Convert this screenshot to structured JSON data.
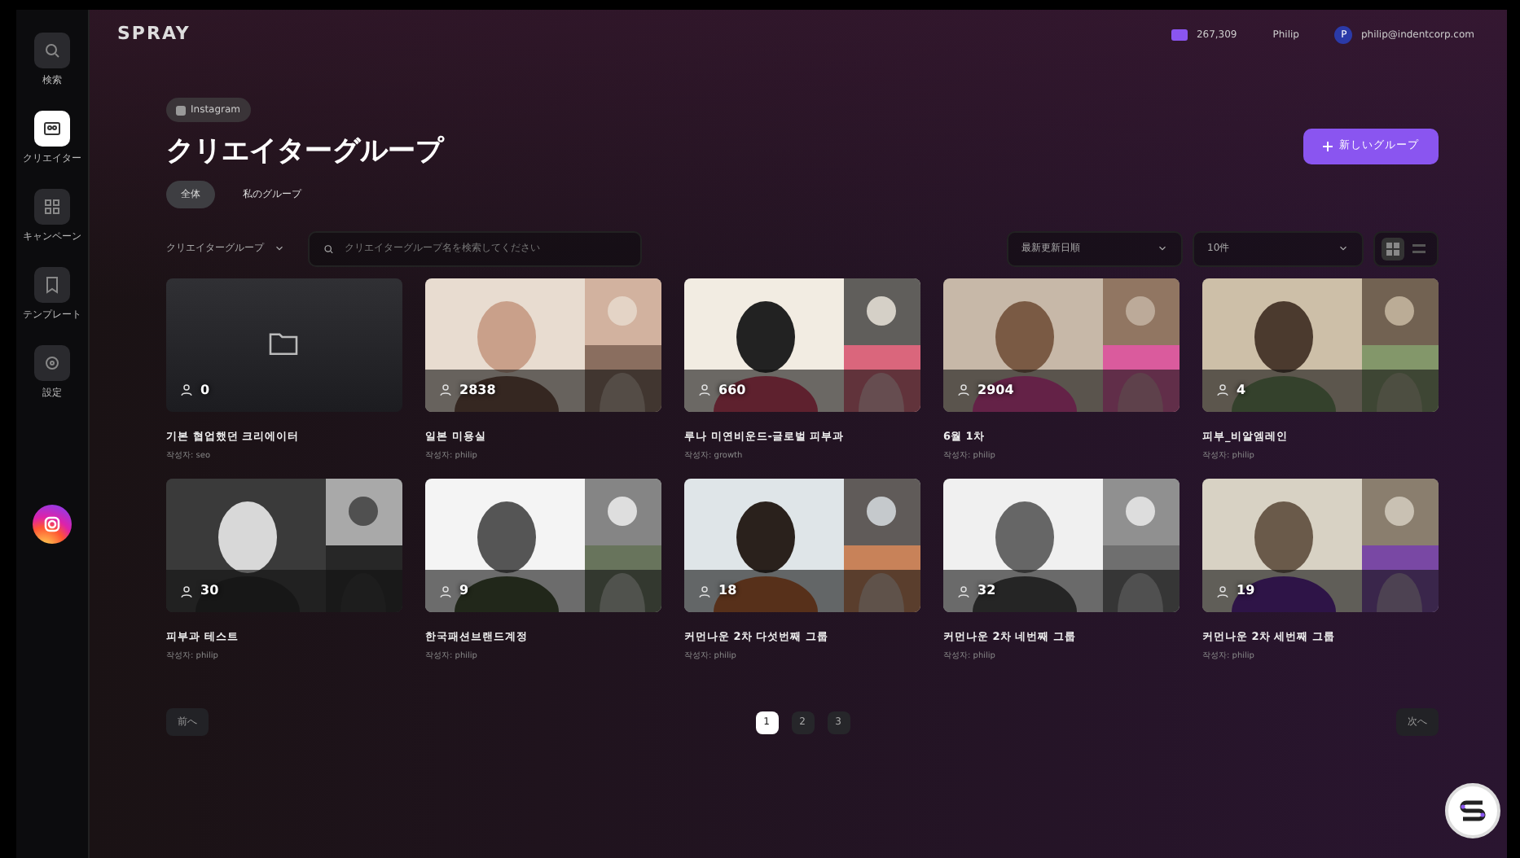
{
  "sidebar": {
    "items": [
      {
        "kind": "search",
        "label": "検索",
        "selected": false
      },
      {
        "kind": "creator",
        "label": "クリエイター",
        "selected": true
      },
      {
        "kind": "campaign",
        "label": "キャンペーン",
        "selected": false
      },
      {
        "kind": "template",
        "label": "テンプレート",
        "selected": false
      },
      {
        "kind": "settings",
        "label": "設定",
        "selected": false
      }
    ]
  },
  "header": {
    "logo": "SPRAY",
    "credits": "267,309",
    "workspace": "Philip",
    "avatar_letter": "P",
    "email": "philip@indentcorp.com"
  },
  "platform_chip": "Instagram",
  "title": "クリエイターグループ",
  "new_button": "新しいグループ",
  "tabs": [
    {
      "label": "全体",
      "selected": true
    },
    {
      "label": "私のグループ",
      "selected": false
    }
  ],
  "filters": {
    "group_dropdown": "クリエイターグループ",
    "search_placeholder": "クリエイターグループ名を検索してください",
    "sort": "最新更新日順",
    "page_size": "10件",
    "views": [
      {
        "kind": "grid",
        "selected": true
      },
      {
        "kind": "list",
        "selected": false
      }
    ]
  },
  "groups": [
    {
      "kind": "empty",
      "count": "0",
      "name": "기본 협업했던 크리에이터",
      "author": "작성자: seo"
    },
    {
      "kind": "picture",
      "count": "2838",
      "name": "일본 미용실",
      "author": "작성자: philip"
    },
    {
      "kind": "picture",
      "count": "660",
      "name": "루나 미연비운드-글로벌 피부과",
      "author": "작성자: growth"
    },
    {
      "kind": "picture",
      "count": "2904",
      "name": "6월 1차",
      "author": "작성자: philip"
    },
    {
      "kind": "picture",
      "count": "4",
      "name": "피부_비알엠레인",
      "author": "작성자: philip"
    },
    {
      "kind": "picture",
      "count": "30",
      "name": "피부과 테스트",
      "author": "작성자: philip"
    },
    {
      "kind": "picture",
      "count": "9",
      "name": "한국패션브랜드계정",
      "author": "작성자: philip"
    },
    {
      "kind": "picture",
      "count": "18",
      "name": "커먼나운 2차 다섯번째 그룹",
      "author": "작성자: philip"
    },
    {
      "kind": "picture",
      "count": "32",
      "name": "커먼나운 2차 네번째 그룹",
      "author": "작성자: philip"
    },
    {
      "kind": "picture",
      "count": "19",
      "name": "커먼나운 2차 세번째 그룹",
      "author": "작성자: philip"
    }
  ],
  "pagination": {
    "prev": "前へ",
    "pages": [
      {
        "label": "1",
        "selected": true
      },
      {
        "label": "2",
        "selected": false
      },
      {
        "label": "3",
        "selected": false
      }
    ],
    "next": "次へ"
  }
}
